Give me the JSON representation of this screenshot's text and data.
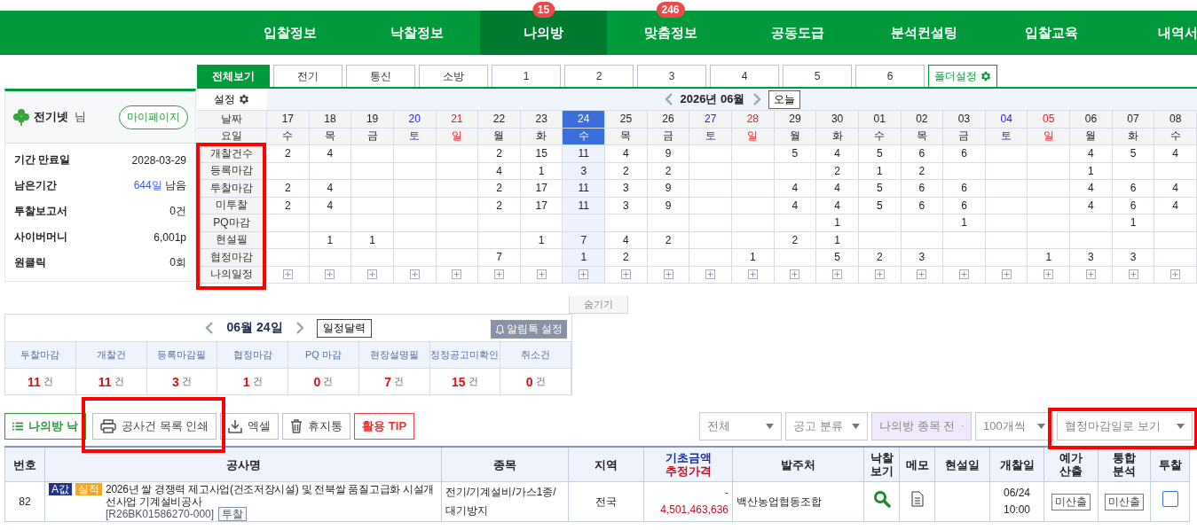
{
  "nav": {
    "items": [
      {
        "label": "입찰정보",
        "selected": false
      },
      {
        "label": "낙찰정보",
        "selected": false
      },
      {
        "label": "나의방",
        "selected": true,
        "badge": "15"
      },
      {
        "label": "맞춤정보",
        "selected": false,
        "badge": "246"
      },
      {
        "label": "공동도급",
        "selected": false
      },
      {
        "label": "분석컨설팅",
        "selected": false
      },
      {
        "label": "입찰교육",
        "selected": false
      },
      {
        "label": "내역서",
        "selected": false
      }
    ]
  },
  "profile": {
    "name": "전기넷",
    "suffix": "님",
    "button": "마이페이지"
  },
  "account": [
    {
      "label": "기간 만료일",
      "value": "2028-03-29"
    },
    {
      "label": "남은기간",
      "accent": "644일",
      "value": "남음"
    },
    {
      "label": "투찰보고서",
      "value": "0건"
    },
    {
      "label": "사이버머니",
      "value": "6,001p"
    },
    {
      "label": "원클릭",
      "value": "0회"
    }
  ],
  "calendar": {
    "tabs": [
      {
        "label": "전체보기",
        "kind": "plain",
        "selected": true
      },
      {
        "label": "전기",
        "kind": "plain",
        "selected": false
      },
      {
        "label": "통신",
        "kind": "plain",
        "selected": false
      },
      {
        "label": "소방",
        "kind": "plain",
        "selected": false
      },
      {
        "label": "1",
        "kind": "plain",
        "selected": false
      },
      {
        "label": "2",
        "kind": "plain",
        "selected": false
      },
      {
        "label": "3",
        "kind": "plain",
        "selected": false
      },
      {
        "label": "4",
        "kind": "plain",
        "selected": false
      },
      {
        "label": "5",
        "kind": "plain",
        "selected": false
      },
      {
        "label": "6",
        "kind": "plain",
        "selected": false
      },
      {
        "label": "폴더설정",
        "kind": "folder",
        "selected": false
      }
    ],
    "settings": "설정",
    "month": "2026년 06월",
    "today_button": "오늘",
    "date_label": "날짜",
    "weekday_label": "요일",
    "schedule_label": "나의일정",
    "days": [
      {
        "date": "17",
        "weekday": "수",
        "kind": "weekday",
        "selected": false
      },
      {
        "date": "18",
        "weekday": "목",
        "kind": "weekday",
        "selected": false
      },
      {
        "date": "19",
        "weekday": "금",
        "kind": "weekday",
        "selected": false
      },
      {
        "date": "20",
        "weekday": "토",
        "kind": "saturday",
        "selected": false
      },
      {
        "date": "21",
        "weekday": "일",
        "kind": "sunday",
        "selected": false
      },
      {
        "date": "22",
        "weekday": "월",
        "kind": "weekday",
        "selected": false
      },
      {
        "date": "23",
        "weekday": "화",
        "kind": "weekday",
        "selected": false
      },
      {
        "date": "24",
        "weekday": "수",
        "kind": "weekday",
        "selected": true
      },
      {
        "date": "25",
        "weekday": "목",
        "kind": "weekday",
        "selected": false
      },
      {
        "date": "26",
        "weekday": "금",
        "kind": "weekday",
        "selected": false
      },
      {
        "date": "27",
        "weekday": "토",
        "kind": "saturday",
        "selected": false
      },
      {
        "date": "28",
        "weekday": "일",
        "kind": "sunday",
        "selected": false
      },
      {
        "date": "29",
        "weekday": "월",
        "kind": "weekday",
        "selected": false
      },
      {
        "date": "30",
        "weekday": "화",
        "kind": "weekday",
        "selected": false
      },
      {
        "date": "01",
        "weekday": "수",
        "kind": "weekday",
        "selected": false
      },
      {
        "date": "02",
        "weekday": "목",
        "kind": "weekday",
        "selected": false
      },
      {
        "date": "03",
        "weekday": "금",
        "kind": "weekday",
        "selected": false
      },
      {
        "date": "04",
        "weekday": "토",
        "kind": "saturday",
        "selected": false
      },
      {
        "date": "05",
        "weekday": "일",
        "kind": "sunday",
        "selected": false
      },
      {
        "date": "06",
        "weekday": "월",
        "kind": "weekday",
        "selected": false
      },
      {
        "date": "07",
        "weekday": "화",
        "kind": "weekday",
        "selected": false
      },
      {
        "date": "08",
        "weekday": "수",
        "kind": "weekday",
        "selected": false
      }
    ],
    "rows": [
      {
        "label": "개찰건수",
        "cells": [
          {
            "kind": "count",
            "value": "2"
          },
          {
            "kind": "count",
            "value": "4"
          },
          {
            "kind": "blank"
          },
          {
            "kind": "blank"
          },
          {
            "kind": "blank"
          },
          {
            "kind": "count",
            "value": "2"
          },
          {
            "kind": "count",
            "value": "15"
          },
          {
            "kind": "count",
            "value": "11"
          },
          {
            "kind": "count",
            "value": "4"
          },
          {
            "kind": "count",
            "value": "9"
          },
          {
            "kind": "blank"
          },
          {
            "kind": "blank"
          },
          {
            "kind": "count",
            "value": "5"
          },
          {
            "kind": "count",
            "value": "4"
          },
          {
            "kind": "count",
            "value": "5"
          },
          {
            "kind": "count",
            "value": "6"
          },
          {
            "kind": "count",
            "value": "6"
          },
          {
            "kind": "blank"
          },
          {
            "kind": "blank"
          },
          {
            "kind": "count",
            "value": "4"
          },
          {
            "kind": "count",
            "value": "5"
          },
          {
            "kind": "count",
            "value": "4"
          }
        ]
      },
      {
        "label": "등록마감",
        "cells": [
          {
            "kind": "blank"
          },
          {
            "kind": "blank"
          },
          {
            "kind": "blank"
          },
          {
            "kind": "blank"
          },
          {
            "kind": "blank"
          },
          {
            "kind": "count",
            "value": "4"
          },
          {
            "kind": "count",
            "value": "1"
          },
          {
            "kind": "count",
            "value": "3"
          },
          {
            "kind": "count",
            "value": "2"
          },
          {
            "kind": "count",
            "value": "2"
          },
          {
            "kind": "blank"
          },
          {
            "kind": "blank"
          },
          {
            "kind": "blank"
          },
          {
            "kind": "count",
            "value": "2"
          },
          {
            "kind": "count",
            "value": "1"
          },
          {
            "kind": "count",
            "value": "2"
          },
          {
            "kind": "blank"
          },
          {
            "kind": "blank"
          },
          {
            "kind": "blank"
          },
          {
            "kind": "count",
            "value": "1"
          },
          {
            "kind": "blank"
          },
          {
            "kind": "blank"
          }
        ]
      },
      {
        "label": "투찰마감",
        "cells": [
          {
            "kind": "count",
            "value": "2"
          },
          {
            "kind": "count",
            "value": "4"
          },
          {
            "kind": "blank"
          },
          {
            "kind": "blank"
          },
          {
            "kind": "blank"
          },
          {
            "kind": "count",
            "value": "2"
          },
          {
            "kind": "count",
            "value": "17"
          },
          {
            "kind": "count",
            "value": "11"
          },
          {
            "kind": "count",
            "value": "3"
          },
          {
            "kind": "count",
            "value": "9"
          },
          {
            "kind": "blank"
          },
          {
            "kind": "blank"
          },
          {
            "kind": "count",
            "value": "4"
          },
          {
            "kind": "count",
            "value": "4"
          },
          {
            "kind": "count",
            "value": "5"
          },
          {
            "kind": "count",
            "value": "6"
          },
          {
            "kind": "count",
            "value": "6"
          },
          {
            "kind": "blank"
          },
          {
            "kind": "blank"
          },
          {
            "kind": "count",
            "value": "4"
          },
          {
            "kind": "count",
            "value": "6"
          },
          {
            "kind": "count",
            "value": "4"
          }
        ]
      },
      {
        "label": "미투찰",
        "cells": [
          {
            "kind": "count",
            "value": "2"
          },
          {
            "kind": "count",
            "value": "4"
          },
          {
            "kind": "blank"
          },
          {
            "kind": "blank"
          },
          {
            "kind": "blank"
          },
          {
            "kind": "count",
            "value": "2"
          },
          {
            "kind": "count",
            "value": "17"
          },
          {
            "kind": "count",
            "value": "11"
          },
          {
            "kind": "count",
            "value": "3"
          },
          {
            "kind": "count",
            "value": "9"
          },
          {
            "kind": "blank"
          },
          {
            "kind": "blank"
          },
          {
            "kind": "count",
            "value": "4"
          },
          {
            "kind": "count",
            "value": "4"
          },
          {
            "kind": "count",
            "value": "5"
          },
          {
            "kind": "count",
            "value": "6"
          },
          {
            "kind": "count",
            "value": "6"
          },
          {
            "kind": "blank"
          },
          {
            "kind": "blank"
          },
          {
            "kind": "count",
            "value": "4"
          },
          {
            "kind": "count",
            "value": "6"
          },
          {
            "kind": "count",
            "value": "4"
          }
        ]
      },
      {
        "label": "PQ마감",
        "cells": [
          {
            "kind": "blank"
          },
          {
            "kind": "blank"
          },
          {
            "kind": "blank"
          },
          {
            "kind": "blank"
          },
          {
            "kind": "blank"
          },
          {
            "kind": "blank"
          },
          {
            "kind": "blank"
          },
          {
            "kind": "blank"
          },
          {
            "kind": "blank"
          },
          {
            "kind": "blank"
          },
          {
            "kind": "blank"
          },
          {
            "kind": "blank"
          },
          {
            "kind": "blank"
          },
          {
            "kind": "count",
            "value": "1"
          },
          {
            "kind": "blank"
          },
          {
            "kind": "blank"
          },
          {
            "kind": "count",
            "value": "1"
          },
          {
            "kind": "blank"
          },
          {
            "kind": "blank"
          },
          {
            "kind": "blank"
          },
          {
            "kind": "count",
            "value": "1"
          },
          {
            "kind": "blank"
          }
        ]
      },
      {
        "label": "현설필",
        "cells": [
          {
            "kind": "blank"
          },
          {
            "kind": "count",
            "value": "1"
          },
          {
            "kind": "count",
            "value": "1"
          },
          {
            "kind": "blank"
          },
          {
            "kind": "blank"
          },
          {
            "kind": "blank"
          },
          {
            "kind": "count",
            "value": "1"
          },
          {
            "kind": "count",
            "value": "7"
          },
          {
            "kind": "count",
            "value": "4"
          },
          {
            "kind": "count",
            "value": "2"
          },
          {
            "kind": "blank"
          },
          {
            "kind": "blank"
          },
          {
            "kind": "count",
            "value": "2"
          },
          {
            "kind": "count",
            "value": "1"
          },
          {
            "kind": "blank"
          },
          {
            "kind": "blank"
          },
          {
            "kind": "blank"
          },
          {
            "kind": "blank"
          },
          {
            "kind": "blank"
          },
          {
            "kind": "blank"
          },
          {
            "kind": "blank"
          },
          {
            "kind": "blank"
          }
        ]
      },
      {
        "label": "협정마감",
        "cells": [
          {
            "kind": "blank"
          },
          {
            "kind": "blank"
          },
          {
            "kind": "blank"
          },
          {
            "kind": "blank"
          },
          {
            "kind": "blank"
          },
          {
            "kind": "count",
            "value": "7"
          },
          {
            "kind": "blank"
          },
          {
            "kind": "count",
            "value": "1"
          },
          {
            "kind": "count",
            "value": "2"
          },
          {
            "kind": "blank"
          },
          {
            "kind": "blank"
          },
          {
            "kind": "count",
            "value": "1"
          },
          {
            "kind": "blank"
          },
          {
            "kind": "count",
            "value": "5"
          },
          {
            "kind": "count",
            "value": "2"
          },
          {
            "kind": "count",
            "value": "3"
          },
          {
            "kind": "blank"
          },
          {
            "kind": "blank"
          },
          {
            "kind": "count",
            "value": "1"
          },
          {
            "kind": "count",
            "value": "3"
          },
          {
            "kind": "count",
            "value": "3"
          },
          {
            "kind": "blank"
          }
        ]
      }
    ]
  },
  "hide_tab": "숨기기",
  "summary": {
    "date": "06월 24일",
    "calendar_button": "일정달력",
    "alert_button": "알림톡 설정",
    "items": [
      {
        "label": "투찰마감",
        "count": "11",
        "unit": "건"
      },
      {
        "label": "개찰건",
        "count": "11",
        "unit": "건"
      },
      {
        "label": "등록마감필",
        "count": "3",
        "unit": "건"
      },
      {
        "label": "협정마감",
        "count": "1",
        "unit": "건"
      },
      {
        "label": "PQ 마감",
        "count": "0",
        "unit": "건"
      },
      {
        "label": "현장설명필",
        "count": "7",
        "unit": "건"
      },
      {
        "label": "정정공고미확인",
        "count": "15",
        "unit": "건"
      },
      {
        "label": "취소건",
        "count": "0",
        "unit": "건"
      }
    ]
  },
  "toolbar": {
    "buttons": [
      {
        "label": "나의방 낙",
        "kind": "list"
      },
      {
        "label": "공사건 목록 인쇄",
        "kind": "print"
      },
      {
        "label": "엑셀",
        "kind": "download"
      },
      {
        "label": "휴지통",
        "kind": "trash"
      },
      {
        "label": "활용 TIP",
        "kind": "tip"
      }
    ],
    "selects": [
      {
        "value": "전체",
        "highlighted": false
      },
      {
        "value": "공고 분류",
        "highlighted": false
      },
      {
        "value": "나의방 종목 전",
        "highlighted": true
      },
      {
        "value": "100개씩",
        "highlighted": false
      },
      {
        "value": "협정마감일로 보기",
        "highlighted": false
      }
    ]
  },
  "table": {
    "columns": [
      {
        "lines": [
          "번호"
        ],
        "kind": "plain"
      },
      {
        "lines": [
          "공사명"
        ],
        "kind": "plain"
      },
      {
        "lines": [
          "종목"
        ],
        "kind": "plain"
      },
      {
        "lines": [
          "지역"
        ],
        "kind": "plain"
      },
      {
        "lines": [
          "기초금액",
          "추정가격"
        ],
        "kind": "price"
      },
      {
        "lines": [
          "발주처"
        ],
        "kind": "plain"
      },
      {
        "lines": [
          "낙찰",
          "보기"
        ],
        "kind": "plain"
      },
      {
        "lines": [
          "메모"
        ],
        "kind": "plain"
      },
      {
        "lines": [
          "현설일"
        ],
        "kind": "plain"
      },
      {
        "lines": [
          "개찰일"
        ],
        "kind": "plain"
      },
      {
        "lines": [
          "예가",
          "산출"
        ],
        "kind": "plain"
      },
      {
        "lines": [
          "통합",
          "분석"
        ],
        "kind": "plain"
      },
      {
        "lines": [
          "투찰"
        ],
        "kind": "plain"
      }
    ],
    "rows": [
      {
        "no": "82",
        "tags": [
          {
            "label": "A값",
            "kind": "a_value"
          },
          {
            "label": "실적",
            "kind": "record"
          }
        ],
        "title": "2026년 쌀 경쟁력 제고사업(건조저장시설) 및 전북쌀 품질고급화 시설개선사업 기계설비공사",
        "code": "[R26BK01586270-000]",
        "bid_tag": "투찰",
        "category": "전기/기계설비/가스1종/대기방지",
        "region": "전국",
        "base_price": "-",
        "estimated_price": "4,501,463,636",
        "agency": "백산농업협동조합",
        "open_date": "06/24",
        "open_time": "10:00",
        "estimate": "미산출",
        "analysis": "미산출",
        "bid_checked": false
      }
    ]
  }
}
